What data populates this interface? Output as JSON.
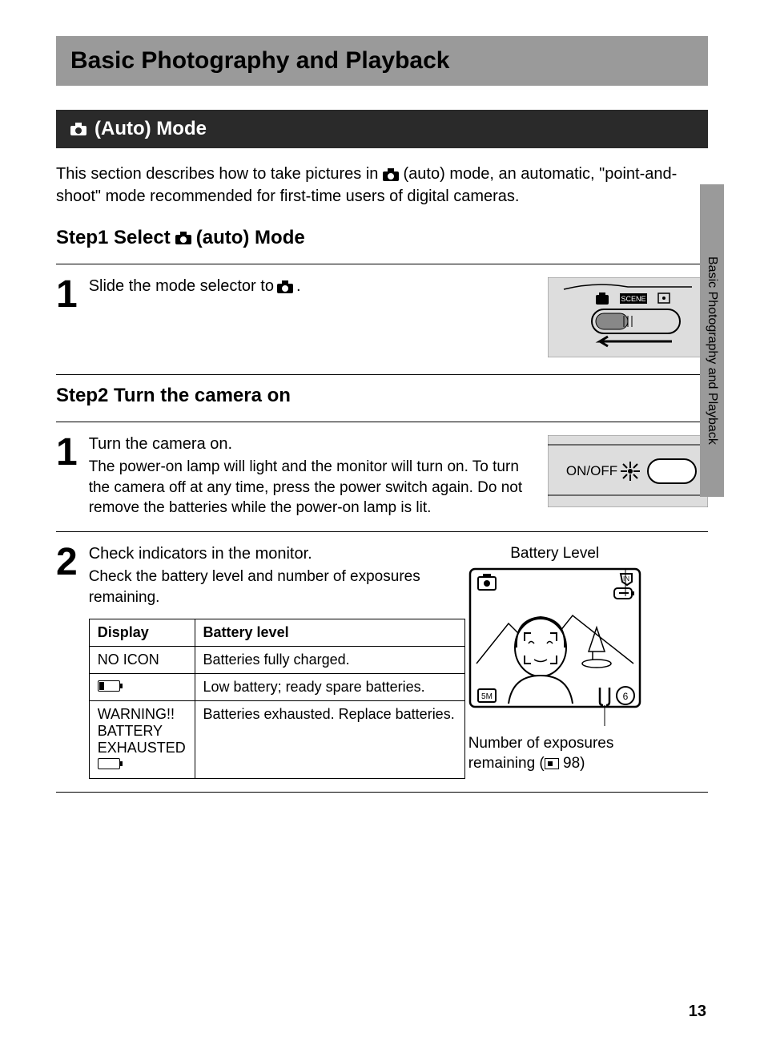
{
  "chapter_title": "Basic Photography and Playback",
  "section_title": "(Auto) Mode",
  "intro_before": "This section describes how to take pictures in ",
  "intro_after": " (auto) mode, an automatic, \"point-and-shoot\" mode recommended for first-time users of digital cameras.",
  "step1_heading_a": "Step1 Select ",
  "step1_heading_b": " (auto) Mode",
  "step1": {
    "num": "1",
    "title_before": "Slide the mode selector to ",
    "title_after": "."
  },
  "step2_heading": "Step2 Turn the camera on",
  "step2_1": {
    "num": "1",
    "title": "Turn the camera on.",
    "desc": "The power-on lamp will light and the monitor will turn on. To turn the camera off at any time, press the power switch again. Do not remove the batteries while the power-on lamp is lit."
  },
  "step2_2": {
    "num": "2",
    "title": "Check indicators in the monitor.",
    "desc": "Check the battery level and number of exposures remaining."
  },
  "table": {
    "h1": "Display",
    "h2": "Battery level",
    "r1c1": "NO ICON",
    "r1c2": "Batteries fully charged.",
    "r2c2": "Low battery; ready spare batteries.",
    "r3c1a": "WARNING!!",
    "r3c1b": "BATTERY",
    "r3c1c": "EXHAUSTED",
    "r3c2": "Batteries exhausted. Replace batteries."
  },
  "monitor": {
    "caption": "Battery Level",
    "desc_a": "Number of exposures remaining (",
    "desc_b": " 98)"
  },
  "illus": {
    "onoff": "ON/OFF",
    "scene": "SCENE",
    "five_m": "5M",
    "six": "6",
    "in": "IN"
  },
  "sidebar": "Basic Photography and Playback",
  "page_number": "13"
}
